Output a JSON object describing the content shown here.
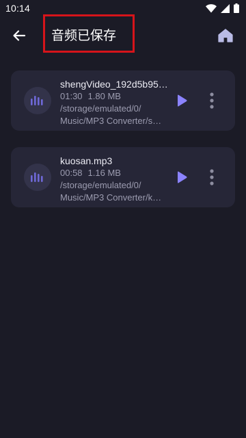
{
  "status_bar": {
    "time": "10:14",
    "icons": [
      "wifi-icon",
      "signal-icon",
      "battery-icon"
    ]
  },
  "header": {
    "back_icon": "arrow-left-icon",
    "title": "音频已保存",
    "home_icon": "home-icon"
  },
  "files": [
    {
      "name": "shengVideo_192d5b95…",
      "duration": "01:30",
      "size": "1.80 MB",
      "path_line1": "/storage/emulated/0/",
      "path_line2": "Music/MP3 Converter/s…"
    },
    {
      "name": "kuosan.mp3",
      "duration": "00:58",
      "size": "1.16 MB",
      "path_line1": "/storage/emulated/0/",
      "path_line2": "Music/MP3 Converter/k…"
    }
  ],
  "colors": {
    "background": "#1b1b26",
    "card": "#262637",
    "accent": "#8b83ff",
    "highlight_border": "#d6141a"
  }
}
